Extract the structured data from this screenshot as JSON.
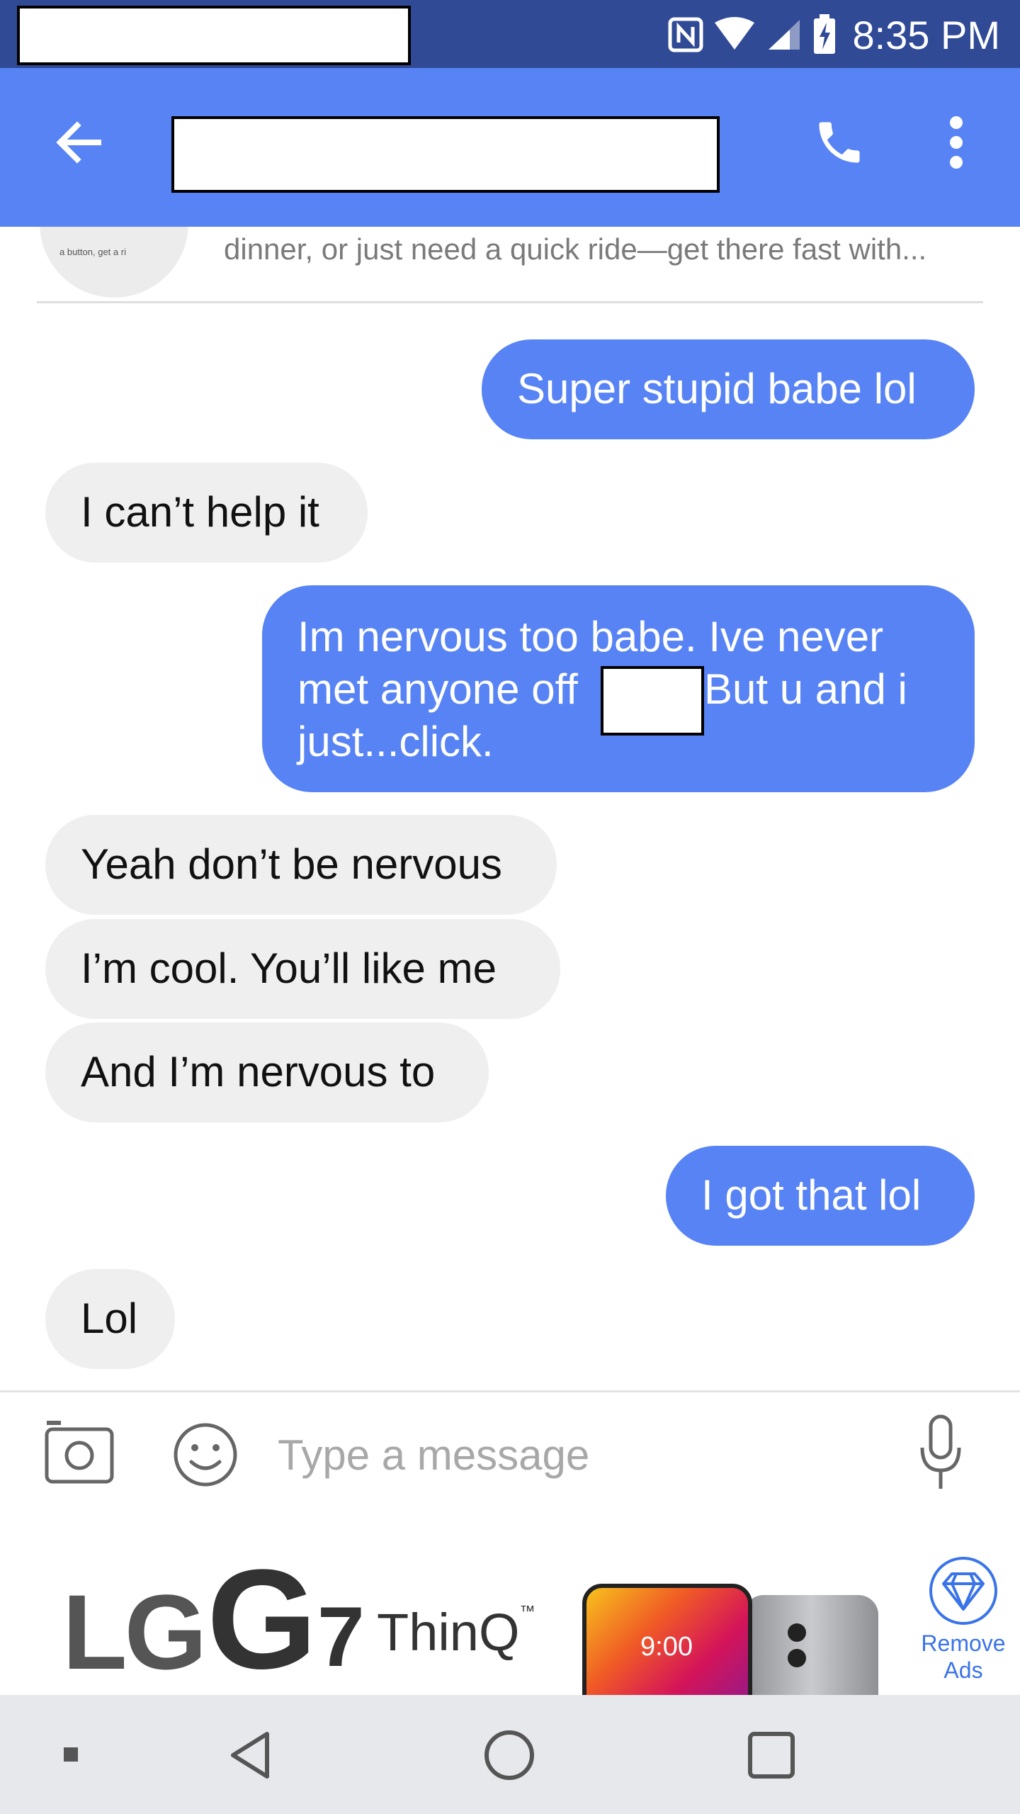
{
  "status_bar": {
    "time": "8:35 PM",
    "icons": [
      "nfc-icon",
      "wifi-icon",
      "signal-icon",
      "battery-charging-icon"
    ]
  },
  "app_bar": {
    "back_icon": "arrow-left-icon",
    "call_icon": "phone-icon",
    "menu_icon": "more-vertical-icon"
  },
  "ad_preview": {
    "thumb_text": "a button, get a ri",
    "text": "dinner, or just need a quick ride—get there fast with..."
  },
  "messages": [
    {
      "direction": "sent",
      "text": "Super stupid babe lol"
    },
    {
      "direction": "received",
      "text": "I can’t help it"
    },
    {
      "direction": "sent",
      "lines": [
        "Im nervous too babe. Ive never",
        "met anyone off",
        "But u and i",
        "just...click."
      ]
    },
    {
      "direction": "received",
      "text": "Yeah don’t be nervous"
    },
    {
      "direction": "received",
      "text": "I’m cool. You’ll like me"
    },
    {
      "direction": "received",
      "text": "And I’m nervous to"
    },
    {
      "direction": "sent",
      "text": "I got that lol"
    },
    {
      "direction": "received",
      "text": "Lol"
    }
  ],
  "input_bar": {
    "camera_icon": "camera-icon",
    "emoji_icon": "smiley-icon",
    "placeholder": "Type a message",
    "mic_icon": "microphone-icon"
  },
  "banner_ad": {
    "brand": "LG",
    "model_g": "G",
    "model_num": "7",
    "model_suffix": "ThinQ",
    "tm": "™",
    "phone_time": "9:00",
    "remove_ads_line1": "Remove",
    "remove_ads_line2": "Ads",
    "remove_ads_icon": "diamond-icon"
  },
  "nav_bar": {
    "icons": [
      "dot-icon",
      "back-triangle-icon",
      "home-circle-icon",
      "recents-square-icon"
    ]
  }
}
